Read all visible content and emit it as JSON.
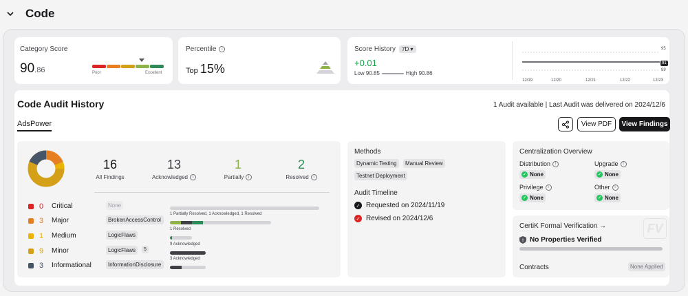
{
  "header": {
    "title": "Code"
  },
  "category_score": {
    "label": "Category Score",
    "score_int": "90",
    "score_dec": ".86",
    "poor_label": "Poor",
    "excellent_label": "Excellent",
    "bar_colors": [
      "#dc2626",
      "#e67e22",
      "#d4a017",
      "#8fb34a",
      "#2e8b57"
    ],
    "level": 0.9086
  },
  "percentile": {
    "label": "Percentile",
    "prefix": "Top",
    "value": "15%"
  },
  "score_history": {
    "label": "Score History",
    "period": "7D",
    "delta": "+0.01",
    "low": "Low 90.85",
    "high": "High 90.86",
    "x_ticks": [
      "12/19",
      "12/20",
      "12/21",
      "12/22",
      "12/23"
    ],
    "y_ticks": [
      "95",
      "91",
      "89"
    ]
  },
  "audit": {
    "title": "Code Audit History",
    "summary": "1 Audit available | Last Audit was delivered on 2024/12/6",
    "project": "AdsPower",
    "view_pdf": "View PDF",
    "view_findings": "View Findings",
    "stats": [
      {
        "value": "16",
        "label": "All Findings",
        "color": "#18181b"
      },
      {
        "value": "13",
        "label": "Acknowledged",
        "color": "#3f3f46"
      },
      {
        "value": "1",
        "label": "Partially",
        "color": "#8fb34a"
      },
      {
        "value": "2",
        "label": "Resolved",
        "color": "#2e8b57"
      }
    ],
    "severities": [
      {
        "count": "0",
        "name": "Critical",
        "color": "#dc2626",
        "tag": "None",
        "status": ""
      },
      {
        "count": "3",
        "name": "Major",
        "color": "#e67e22",
        "tag": "BrokenAccessControl",
        "status": "1 Partially Resolved, 1 Acknowledged, 1 Resolved"
      },
      {
        "count": "1",
        "name": "Medium",
        "color": "#eab308",
        "tag": "LogicFlaws",
        "status": "1 Resolved"
      },
      {
        "count": "9",
        "name": "Minor",
        "color": "#d4a017",
        "tag": "LogicFlaws",
        "extra": "5",
        "status": "9 Acknowledged"
      },
      {
        "count": "3",
        "name": "Informational",
        "color": "#475569",
        "tag": "InformationDisclosure",
        "status": "3 Acknowledged"
      }
    ]
  },
  "methods": {
    "title": "Methods",
    "items": [
      "Dynamic Testing",
      "Manual Review",
      "Testnet Deployment"
    ],
    "timeline_title": "Audit Timeline",
    "timeline": [
      {
        "text": "Requested on 2024/11/19",
        "color": "#18181b"
      },
      {
        "text": "Revised on 2024/12/6",
        "color": "#dc2626"
      }
    ]
  },
  "centralization": {
    "title": "Centralization Overview",
    "items": [
      {
        "label": "Distribution",
        "value": "None"
      },
      {
        "label": "Upgrade",
        "value": "None"
      },
      {
        "label": "Privilege",
        "value": "None"
      },
      {
        "label": "Other",
        "value": "None"
      }
    ]
  },
  "certik": {
    "title": "CertiK Formal Verification →",
    "status": "No Properties Verified",
    "contracts_label": "Contracts",
    "contracts_value": "None Applied",
    "watermark": "FV"
  }
}
